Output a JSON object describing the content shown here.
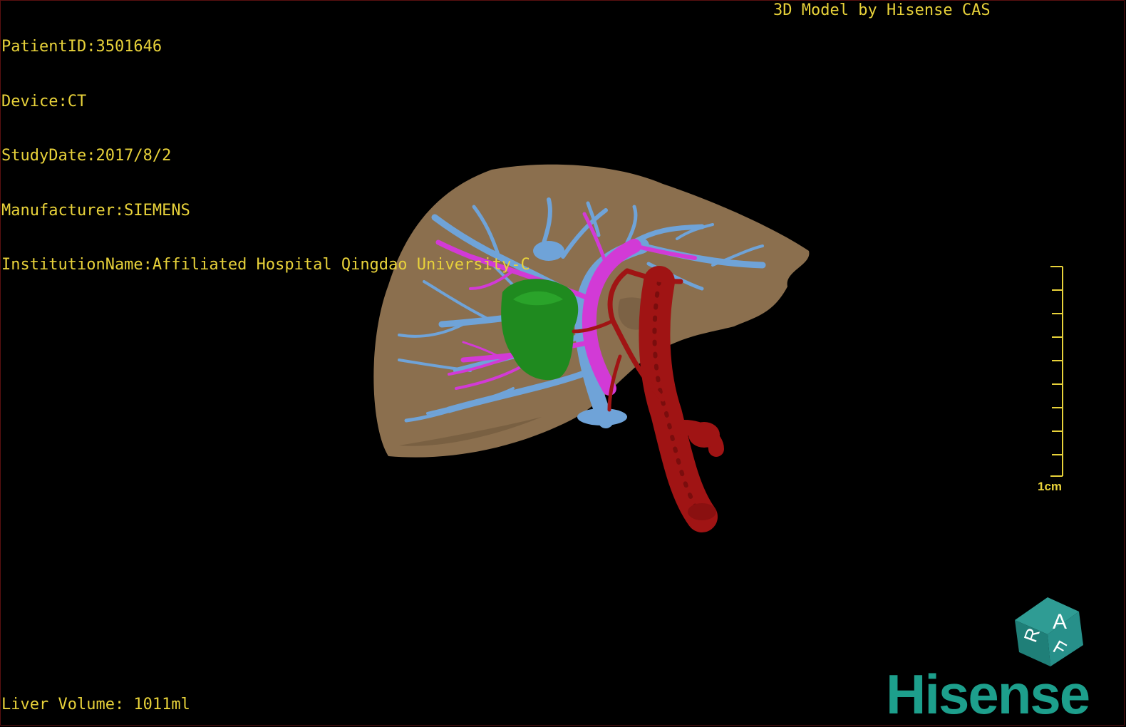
{
  "patient": {
    "id_line": "PatientID:3501646",
    "device_line": "Device:CT",
    "study_date_line": "StudyDate:2017/8/2",
    "manufacturer_line": "Manufacturer:SIEMENS",
    "institution_line": "InstitutionName:Affiliated Hospital Qingdao University-C"
  },
  "credit": "3D Model by Hisense CAS",
  "volume_line": "Liver Volume: 1011ml",
  "scale": {
    "label": "1cm"
  },
  "orientation_cube": {
    "faces": [
      "A",
      "R",
      "F"
    ]
  },
  "brand": "Hisense",
  "colors": {
    "text": "#e8d23a",
    "liver": "#8b6f4e",
    "portal_vein": "#6fa3d8",
    "hepatic_vein": "#d23ad6",
    "artery": "#a01414",
    "tumor": "#1f8a1f",
    "brand": "#1d9f8c"
  }
}
